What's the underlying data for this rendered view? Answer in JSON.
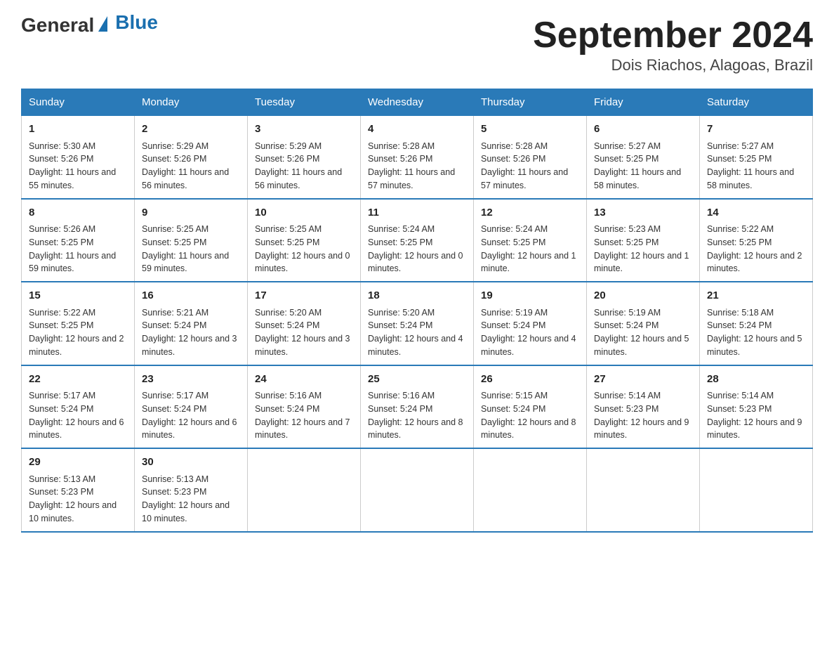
{
  "logo": {
    "general": "General",
    "blue": "Blue"
  },
  "title": "September 2024",
  "subtitle": "Dois Riachos, Alagoas, Brazil",
  "days_of_week": [
    "Sunday",
    "Monday",
    "Tuesday",
    "Wednesday",
    "Thursday",
    "Friday",
    "Saturday"
  ],
  "weeks": [
    [
      {
        "day": "1",
        "sunrise": "5:30 AM",
        "sunset": "5:26 PM",
        "daylight": "11 hours and 55 minutes."
      },
      {
        "day": "2",
        "sunrise": "5:29 AM",
        "sunset": "5:26 PM",
        "daylight": "11 hours and 56 minutes."
      },
      {
        "day": "3",
        "sunrise": "5:29 AM",
        "sunset": "5:26 PM",
        "daylight": "11 hours and 56 minutes."
      },
      {
        "day": "4",
        "sunrise": "5:28 AM",
        "sunset": "5:26 PM",
        "daylight": "11 hours and 57 minutes."
      },
      {
        "day": "5",
        "sunrise": "5:28 AM",
        "sunset": "5:26 PM",
        "daylight": "11 hours and 57 minutes."
      },
      {
        "day": "6",
        "sunrise": "5:27 AM",
        "sunset": "5:25 PM",
        "daylight": "11 hours and 58 minutes."
      },
      {
        "day": "7",
        "sunrise": "5:27 AM",
        "sunset": "5:25 PM",
        "daylight": "11 hours and 58 minutes."
      }
    ],
    [
      {
        "day": "8",
        "sunrise": "5:26 AM",
        "sunset": "5:25 PM",
        "daylight": "11 hours and 59 minutes."
      },
      {
        "day": "9",
        "sunrise": "5:25 AM",
        "sunset": "5:25 PM",
        "daylight": "11 hours and 59 minutes."
      },
      {
        "day": "10",
        "sunrise": "5:25 AM",
        "sunset": "5:25 PM",
        "daylight": "12 hours and 0 minutes."
      },
      {
        "day": "11",
        "sunrise": "5:24 AM",
        "sunset": "5:25 PM",
        "daylight": "12 hours and 0 minutes."
      },
      {
        "day": "12",
        "sunrise": "5:24 AM",
        "sunset": "5:25 PM",
        "daylight": "12 hours and 1 minute."
      },
      {
        "day": "13",
        "sunrise": "5:23 AM",
        "sunset": "5:25 PM",
        "daylight": "12 hours and 1 minute."
      },
      {
        "day": "14",
        "sunrise": "5:22 AM",
        "sunset": "5:25 PM",
        "daylight": "12 hours and 2 minutes."
      }
    ],
    [
      {
        "day": "15",
        "sunrise": "5:22 AM",
        "sunset": "5:25 PM",
        "daylight": "12 hours and 2 minutes."
      },
      {
        "day": "16",
        "sunrise": "5:21 AM",
        "sunset": "5:24 PM",
        "daylight": "12 hours and 3 minutes."
      },
      {
        "day": "17",
        "sunrise": "5:20 AM",
        "sunset": "5:24 PM",
        "daylight": "12 hours and 3 minutes."
      },
      {
        "day": "18",
        "sunrise": "5:20 AM",
        "sunset": "5:24 PM",
        "daylight": "12 hours and 4 minutes."
      },
      {
        "day": "19",
        "sunrise": "5:19 AM",
        "sunset": "5:24 PM",
        "daylight": "12 hours and 4 minutes."
      },
      {
        "day": "20",
        "sunrise": "5:19 AM",
        "sunset": "5:24 PM",
        "daylight": "12 hours and 5 minutes."
      },
      {
        "day": "21",
        "sunrise": "5:18 AM",
        "sunset": "5:24 PM",
        "daylight": "12 hours and 5 minutes."
      }
    ],
    [
      {
        "day": "22",
        "sunrise": "5:17 AM",
        "sunset": "5:24 PM",
        "daylight": "12 hours and 6 minutes."
      },
      {
        "day": "23",
        "sunrise": "5:17 AM",
        "sunset": "5:24 PM",
        "daylight": "12 hours and 6 minutes."
      },
      {
        "day": "24",
        "sunrise": "5:16 AM",
        "sunset": "5:24 PM",
        "daylight": "12 hours and 7 minutes."
      },
      {
        "day": "25",
        "sunrise": "5:16 AM",
        "sunset": "5:24 PM",
        "daylight": "12 hours and 8 minutes."
      },
      {
        "day": "26",
        "sunrise": "5:15 AM",
        "sunset": "5:24 PM",
        "daylight": "12 hours and 8 minutes."
      },
      {
        "day": "27",
        "sunrise": "5:14 AM",
        "sunset": "5:23 PM",
        "daylight": "12 hours and 9 minutes."
      },
      {
        "day": "28",
        "sunrise": "5:14 AM",
        "sunset": "5:23 PM",
        "daylight": "12 hours and 9 minutes."
      }
    ],
    [
      {
        "day": "29",
        "sunrise": "5:13 AM",
        "sunset": "5:23 PM",
        "daylight": "12 hours and 10 minutes."
      },
      {
        "day": "30",
        "sunrise": "5:13 AM",
        "sunset": "5:23 PM",
        "daylight": "12 hours and 10 minutes."
      },
      null,
      null,
      null,
      null,
      null
    ]
  ]
}
